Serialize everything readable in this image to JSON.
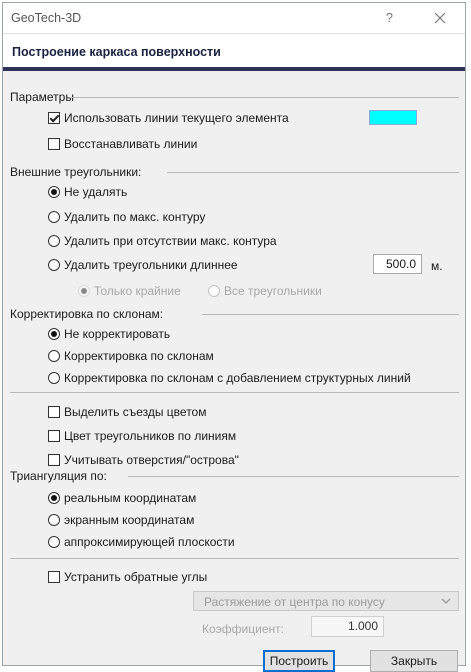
{
  "window": {
    "title": "GeoTech-3D",
    "help_label": "?"
  },
  "header": {
    "title": "Построение каркаса поверхности"
  },
  "params": {
    "label": "Параметры",
    "use_lines_label": "Использовать линии текущего элемента",
    "use_lines_checked": true,
    "line_color": "#00ffff",
    "restore_lines_label": "Восстанавливать линии",
    "restore_lines_checked": false
  },
  "outer": {
    "label": "Внешние треугольники:",
    "options": [
      {
        "label": "Не удалять",
        "checked": true
      },
      {
        "label": "Удалить по макс. контуру",
        "checked": false
      },
      {
        "label": "Удалить при отсутствии макс. контура",
        "checked": false
      },
      {
        "label": "Удалить треугольники длиннее",
        "checked": false
      }
    ],
    "length_value": "500.0",
    "length_unit": "м.",
    "sub_only_edge": "Только крайние",
    "sub_all": "Все треугольники"
  },
  "slope": {
    "label": "Корректировка по склонам:",
    "options": [
      {
        "label": "Не корректировать",
        "checked": true
      },
      {
        "label": "Корректировка по склонам",
        "checked": false
      },
      {
        "label": "Корректировка по склонам с добавлением структурных линий",
        "checked": false
      }
    ]
  },
  "checks": {
    "highlight_ramps": "Выделить съезды цветом",
    "color_by_lines": "Цвет треугольников по линиям",
    "holes_islands": "Учитывать отверстия/\"острова\""
  },
  "triang": {
    "label": "Триангуляция по:",
    "options": [
      {
        "label": "реальным координатам",
        "checked": true
      },
      {
        "label": "экранным координатам",
        "checked": false
      },
      {
        "label": "аппроксимирующей плоскости",
        "checked": false
      }
    ]
  },
  "reverse": {
    "label": "Устранить обратные углы",
    "mode": "Растяжение от центра по конусу",
    "coef_label": "Коэффициент:",
    "coef_value": "1.000"
  },
  "buttons": {
    "build": "Построить",
    "close": "Закрыть"
  }
}
